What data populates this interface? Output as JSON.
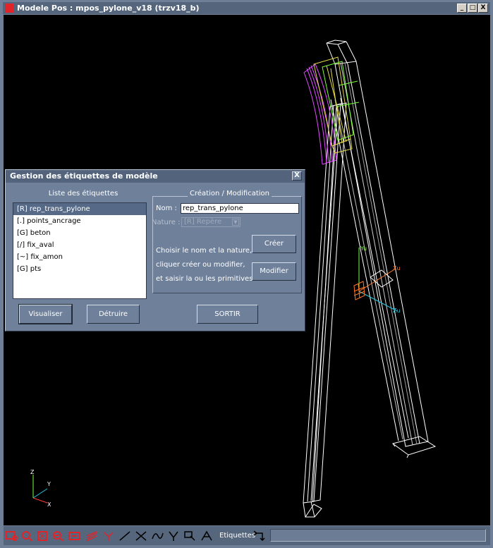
{
  "window": {
    "title": "Modele Pos : mpos_pylone_v18 (trzv18_b)",
    "minimize": "_",
    "maximize": "□",
    "close": "X"
  },
  "dialog": {
    "title": "Gestion des étiquettes de modèle",
    "close": "X",
    "list_title": "Liste des étiquettes",
    "items": [
      "[R] rep_trans_pylone",
      "[.] points_ancrage",
      "[G] beton",
      "[/] fix_aval",
      "[~] fix_amon",
      "[G] pts"
    ],
    "selected_index": 0,
    "group_title": "Création / Modification",
    "nom_label": "Nom :",
    "nom_value": "rep_trans_pylone",
    "nature_label": "Nature :",
    "nature_value": "[R] Repère",
    "help_line1": "Choisir le nom et la nature,",
    "help_line2": "cliquer créer ou modifier,",
    "help_line3": "et saisir la ou les primitives.",
    "creer": "Créer",
    "modifier": "Modifier",
    "visualiser": "Visualiser",
    "detruire": "Détruire",
    "sortir": "SORTIR"
  },
  "viewport": {
    "triad_labels": {
      "z": "Z",
      "y": "Y",
      "x": "X"
    },
    "local_frame_labels": {
      "u": "u",
      "v": "u",
      "w": "u"
    }
  },
  "toolbar": {
    "etiquettes_label": "Etiquettes",
    "icons": [
      "zoom-window-icon",
      "zoom-in-icon",
      "zoom-fit-icon",
      "zoom-out-icon",
      "pan-icon",
      "rotate-icon",
      "multi-rotate-icon",
      "line-icon",
      "node-icon",
      "curve-icon",
      "tree-icon",
      "select-icon",
      "annotate-icon",
      "swap-icon"
    ]
  },
  "colors": {
    "background": "#000000",
    "structure": "#ffffff",
    "magenta": "#e24bff",
    "green": "#7cff3a",
    "yellow": "#e4d94a",
    "orange": "#ff7a2a",
    "cyan": "#22c8e0"
  }
}
